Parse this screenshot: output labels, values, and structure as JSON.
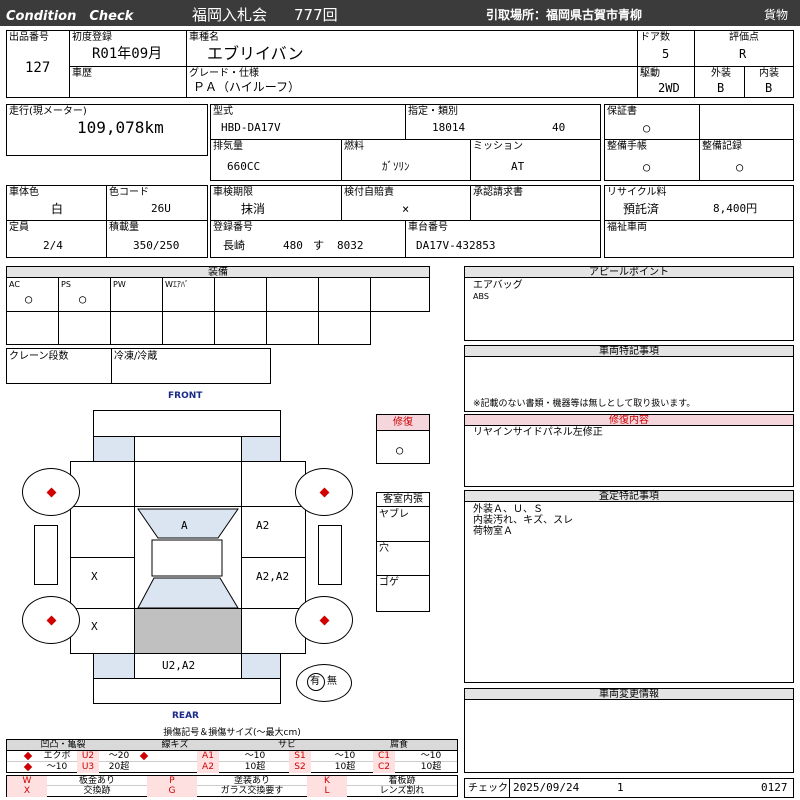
{
  "header": {
    "title_left": "Condition　Check",
    "auction": "福岡入札会",
    "auction_no": "777回",
    "pickup_label": "引取場所：福岡県古賀市青柳",
    "cargo": "貨物"
  },
  "info": {
    "lot_label": "出品番号",
    "lot": "127",
    "first_reg_label": "初度登録",
    "first_reg": "R01年09月",
    "car_name_label": "車種名",
    "car_name": "エブリイバン",
    "doors_label": "ドア数",
    "doors": "5",
    "grade_score_label": "評価点",
    "grade_score": "R",
    "history_label": "車歴",
    "grade_label": "グレード・仕様",
    "grade": "ＰＡ（ハイルーフ）",
    "drive_label": "駆動",
    "drive": "2WD",
    "exterior_label": "外装",
    "exterior": "B",
    "interior_label": "内装",
    "interior": "B"
  },
  "spec": {
    "mileage_label": "走行(現メーター)",
    "mileage": "109,078km",
    "model_label": "型式",
    "model": "HBD-DA17V",
    "designation_label": "指定・類別",
    "designation": "18014",
    "category": "40",
    "warranty_label": "保証書",
    "warranty": "○",
    "displacement_label": "排気量",
    "displacement": "660CC",
    "fuel_label": "燃料",
    "fuel": "ｶﾞｿﾘﾝ",
    "mission_label": "ミッション",
    "mission": "AT",
    "maintenance_label": "整備手帳",
    "maintenance": "○",
    "maintenance_rec_label": "整備記録",
    "maintenance_rec": "○",
    "body_color_label": "車体色",
    "body_color": "白",
    "color_code_label": "色コード",
    "color_code": "26U",
    "inspection_label": "車検期限",
    "inspection": "抹消",
    "self_inspect_label": "検付自賠責",
    "self_inspect": "×",
    "approval_label": "承認請求書",
    "recycle_label": "リサイクル料",
    "recycle_status": "預託済",
    "recycle_fee": "8,400円",
    "capacity_label": "定員",
    "capacity": "2/4",
    "load_label": "積載量",
    "load": "350/250",
    "reg_no_label": "登録番号",
    "reg_area": "長崎",
    "reg_class": "480",
    "reg_kana": "す",
    "reg_num": "8032",
    "chassis_label": "車台番号",
    "chassis": "DA17V-432853",
    "welfare_label": "福祉車両"
  },
  "equipment": {
    "title": "装備",
    "cells": [
      {
        "label": "AC",
        "mark": "○"
      },
      {
        "label": "PS",
        "mark": "○"
      },
      {
        "label": "PW",
        "mark": ""
      },
      {
        "label": "Wｴｱﾊﾞ",
        "mark": ""
      }
    ],
    "crane_label": "クレーン段数",
    "freezer_label": "冷凍/冷蔵"
  },
  "appeal": {
    "title": "アピールポイント",
    "line1": "エアバッグ",
    "line2": "ABS"
  },
  "special": {
    "title": "車両特記事項",
    "note": "※記載のない書類・機器等は無しとして取り扱います。"
  },
  "repair": {
    "title": "修復",
    "mark": "○"
  },
  "repair_detail": {
    "title": "修復内容",
    "text": "リヤインサイドパネル左修正"
  },
  "cabin": {
    "title": "客室内張",
    "r1": "ヤブレ",
    "r2": "穴",
    "r3": "ゴゲ"
  },
  "assess": {
    "title": "査定特記事項",
    "l1": "外装Ａ、Ｕ、Ｓ",
    "l2": "内装汚れ、キズ、スレ",
    "l3": "荷物室Ａ"
  },
  "change": {
    "title": "車両変更情報"
  },
  "diagram": {
    "front": "FRONT",
    "rear": "REAR",
    "m_front": "A",
    "m_right1": "A2",
    "m_right2": "A2,A2",
    "m_left1": "X",
    "m_left2": "X",
    "m_rear": "U2,A2",
    "presence_yes": "有",
    "presence_no": "無"
  },
  "legend": {
    "title": "損傷記号＆損傷サイズ(～最大cm)",
    "h1": "凹凸・亀裂",
    "h2": "線キズ",
    "h3": "サビ",
    "h4": "腐食",
    "r1": [
      "エクボ",
      "U2",
      "～20",
      "A1",
      "～10",
      "S1",
      "～10",
      "C1",
      "～10"
    ],
    "r2": [
      "～10",
      "U3",
      "20超",
      "A2",
      "10超",
      "S2",
      "10超",
      "C2",
      "10超"
    ],
    "k1": [
      "W",
      "板金あり",
      "P",
      "塗装あり",
      "K",
      "着板跡"
    ],
    "k2": [
      "X",
      "交換跡",
      "G",
      "ガラス交換要す",
      "L",
      "レンズ割れ"
    ]
  },
  "footer": {
    "check_label": "チェック",
    "date": "2025/09/24",
    "no": "1",
    "code": "0127"
  },
  "colors": {
    "red": "#d00000",
    "header": "#3b3b3b",
    "panel": "#dbe5f1",
    "pink": "#f5d6dc"
  }
}
